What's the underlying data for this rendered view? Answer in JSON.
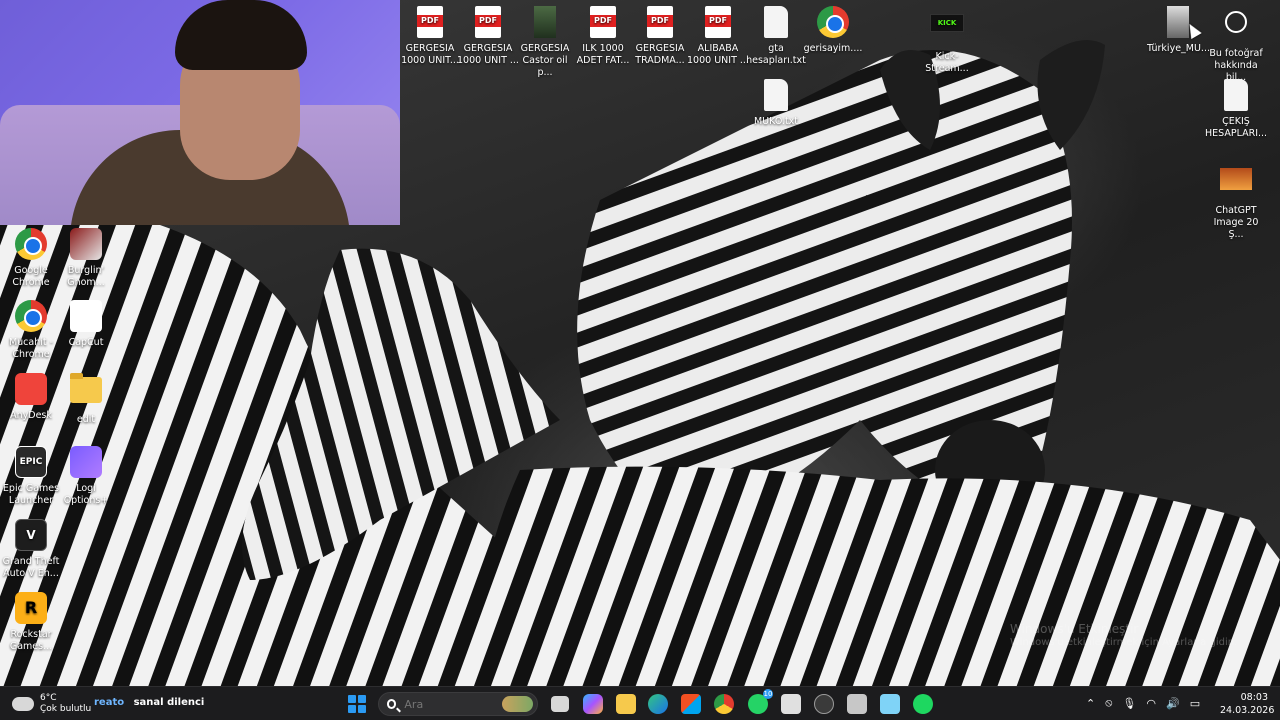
{
  "desktop": {
    "top_icons": [
      {
        "label": "GERGESIA 1000 UNIT...",
        "icon": "pdf-icon"
      },
      {
        "label": "GERGESIA 1000 UNIT ...",
        "icon": "pdf-icon"
      },
      {
        "label": "GERGESIA Castor oil p...",
        "icon": "image-thumbnail-icon"
      },
      {
        "label": "İLK 1000 ADET FAT...",
        "icon": "pdf-icon"
      },
      {
        "label": "GERGESIA TRADMA...",
        "icon": "pdf-icon"
      },
      {
        "label": "ALIBABA 1000 UNIT ...",
        "icon": "pdf-icon"
      },
      {
        "label": "gta hesapları.txt",
        "icon": "text-file-icon"
      },
      {
        "label": "gerisayim....",
        "icon": "chrome-icon"
      },
      {
        "label": "Kick-Stream...",
        "icon": "kick-icon"
      },
      {
        "label": "Türkiye_MU...",
        "icon": "image-thumbnail-icon"
      },
      {
        "label": "Bu fotoğraf hakkında bil...",
        "icon": "info-icon"
      }
    ],
    "second_row": [
      {
        "label": "MUKO.txt",
        "icon": "text-file-icon"
      },
      {
        "label": "ÇEKİŞ HESAPLARI....",
        "icon": "text-file-icon"
      },
      {
        "label": "ChatGPT Image 20 Ş...",
        "icon": "image-thumbnail-icon"
      }
    ],
    "left_icons": [
      {
        "label": "Google Chrome",
        "icon": "chrome-icon"
      },
      {
        "label": "Burglin' Gnom...",
        "icon": "game-icon"
      },
      {
        "label": "Mücahit - Chrome",
        "icon": "chrome-icon"
      },
      {
        "label": "CapCut",
        "icon": "capcut-icon"
      },
      {
        "label": "AnyDesk",
        "icon": "anydesk-icon"
      },
      {
        "label": "edit",
        "icon": "folder-icon"
      },
      {
        "label": "Epic Games Launcher",
        "icon": "epic-games-icon"
      },
      {
        "label": "Logi Options+",
        "icon": "logi-icon"
      },
      {
        "label": "Grand Theft Auto V En...",
        "icon": "gta-icon"
      },
      {
        "label": "Rockstar Games...",
        "icon": "rockstar-icon"
      }
    ],
    "watermark_line1": "Windows'u Etkinleştir",
    "watermark_line2": "Windows'u etkinleştirmek için Ayarlar'a gidin."
  },
  "taskbar": {
    "weather_temp": "6°C",
    "weather_desc": "Çok bulutlu",
    "news_user": "reato",
    "news_text": "sanal dilenci",
    "search_placeholder": "Ara",
    "whatsapp_badge": "10",
    "tray_language": "",
    "clock_time": "08:03",
    "clock_date": "24.03.2026"
  },
  "colors": {
    "taskbar_bg": "#1c1c1e",
    "accent": "#2b9bf4",
    "webcam_bg": "#7c6ae6"
  }
}
